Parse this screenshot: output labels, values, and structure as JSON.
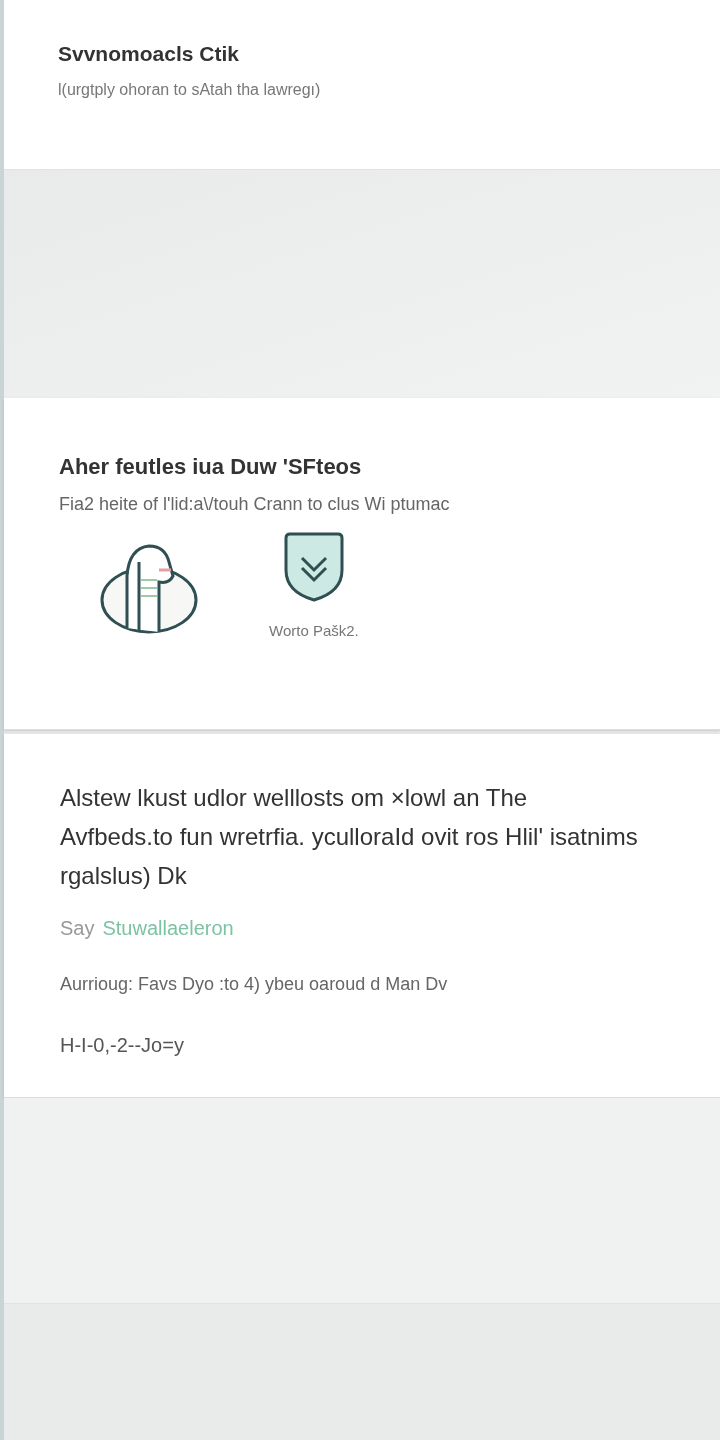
{
  "header": {
    "title": "Svvnomoacls Ctik",
    "subtitle": "l(urgtply ohoran to sAtah tha lawregı)"
  },
  "features": {
    "title": "Aher feutles iua Duw 'SFteos",
    "subtitle": "Fia2 heite of l'lid:a\\/touh Crann to clus Wi ptumac",
    "items": [
      {
        "kind": "scarf"
      },
      {
        "kind": "shield",
        "label": "Worto Pašk2."
      }
    ]
  },
  "info": {
    "paragraph": "Alstew lkust udlor welllosts om ×lowl an The Avfbeds.to fun wretrfia. yculloraId ovit ros Hlil' isatnims rgalslus) Dk",
    "prefix": "Say",
    "link": "Stuwallaeleron",
    "note": "Aurrioug: Favs Dyo :to 4) ybeu oaroud d Man Dv",
    "code": "H-I-0,-2--Jo=y"
  }
}
